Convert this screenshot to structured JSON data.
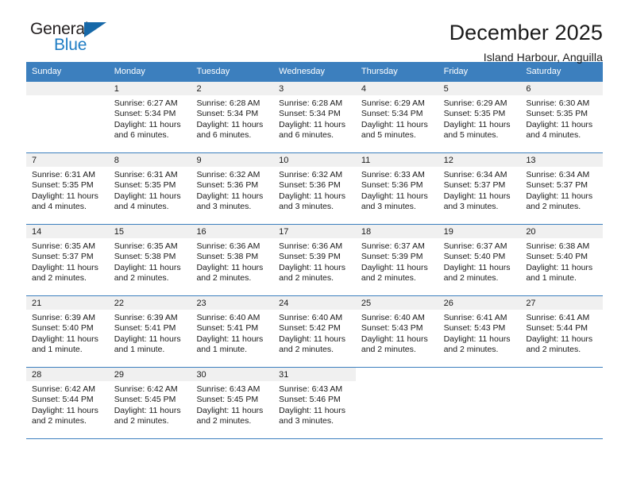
{
  "logo": {
    "word_one": "General",
    "word_two": "Blue",
    "triangle_icon": "triangle-icon"
  },
  "header": {
    "title": "December 2025",
    "subtitle": "Island Harbour, Anguilla"
  },
  "colors": {
    "header_blue": "#3c7fbe",
    "logo_blue": "#1f7dc4",
    "date_strip_gray": "#f0f0f0",
    "text": "#1a1a1a"
  },
  "calendar": {
    "weekday_headers": [
      "Sunday",
      "Monday",
      "Tuesday",
      "Wednesday",
      "Thursday",
      "Friday",
      "Saturday"
    ],
    "weeks": [
      [
        {
          "date": "",
          "lines": [],
          "state": "empty"
        },
        {
          "date": "1",
          "lines": [
            "Sunrise: 6:27 AM",
            "Sunset: 5:34 PM",
            "Daylight: 11 hours",
            "and 6 minutes."
          ],
          "state": "filled"
        },
        {
          "date": "2",
          "lines": [
            "Sunrise: 6:28 AM",
            "Sunset: 5:34 PM",
            "Daylight: 11 hours",
            "and 6 minutes."
          ],
          "state": "filled"
        },
        {
          "date": "3",
          "lines": [
            "Sunrise: 6:28 AM",
            "Sunset: 5:34 PM",
            "Daylight: 11 hours",
            "and 6 minutes."
          ],
          "state": "filled"
        },
        {
          "date": "4",
          "lines": [
            "Sunrise: 6:29 AM",
            "Sunset: 5:34 PM",
            "Daylight: 11 hours",
            "and 5 minutes."
          ],
          "state": "filled"
        },
        {
          "date": "5",
          "lines": [
            "Sunrise: 6:29 AM",
            "Sunset: 5:35 PM",
            "Daylight: 11 hours",
            "and 5 minutes."
          ],
          "state": "filled"
        },
        {
          "date": "6",
          "lines": [
            "Sunrise: 6:30 AM",
            "Sunset: 5:35 PM",
            "Daylight: 11 hours",
            "and 4 minutes."
          ],
          "state": "filled"
        }
      ],
      [
        {
          "date": "7",
          "lines": [
            "Sunrise: 6:31 AM",
            "Sunset: 5:35 PM",
            "Daylight: 11 hours",
            "and 4 minutes."
          ],
          "state": "filled"
        },
        {
          "date": "8",
          "lines": [
            "Sunrise: 6:31 AM",
            "Sunset: 5:35 PM",
            "Daylight: 11 hours",
            "and 4 minutes."
          ],
          "state": "filled"
        },
        {
          "date": "9",
          "lines": [
            "Sunrise: 6:32 AM",
            "Sunset: 5:36 PM",
            "Daylight: 11 hours",
            "and 3 minutes."
          ],
          "state": "filled"
        },
        {
          "date": "10",
          "lines": [
            "Sunrise: 6:32 AM",
            "Sunset: 5:36 PM",
            "Daylight: 11 hours",
            "and 3 minutes."
          ],
          "state": "filled"
        },
        {
          "date": "11",
          "lines": [
            "Sunrise: 6:33 AM",
            "Sunset: 5:36 PM",
            "Daylight: 11 hours",
            "and 3 minutes."
          ],
          "state": "filled"
        },
        {
          "date": "12",
          "lines": [
            "Sunrise: 6:34 AM",
            "Sunset: 5:37 PM",
            "Daylight: 11 hours",
            "and 3 minutes."
          ],
          "state": "filled"
        },
        {
          "date": "13",
          "lines": [
            "Sunrise: 6:34 AM",
            "Sunset: 5:37 PM",
            "Daylight: 11 hours",
            "and 2 minutes."
          ],
          "state": "filled"
        }
      ],
      [
        {
          "date": "14",
          "lines": [
            "Sunrise: 6:35 AM",
            "Sunset: 5:37 PM",
            "Daylight: 11 hours",
            "and 2 minutes."
          ],
          "state": "filled"
        },
        {
          "date": "15",
          "lines": [
            "Sunrise: 6:35 AM",
            "Sunset: 5:38 PM",
            "Daylight: 11 hours",
            "and 2 minutes."
          ],
          "state": "filled"
        },
        {
          "date": "16",
          "lines": [
            "Sunrise: 6:36 AM",
            "Sunset: 5:38 PM",
            "Daylight: 11 hours",
            "and 2 minutes."
          ],
          "state": "filled"
        },
        {
          "date": "17",
          "lines": [
            "Sunrise: 6:36 AM",
            "Sunset: 5:39 PM",
            "Daylight: 11 hours",
            "and 2 minutes."
          ],
          "state": "filled"
        },
        {
          "date": "18",
          "lines": [
            "Sunrise: 6:37 AM",
            "Sunset: 5:39 PM",
            "Daylight: 11 hours",
            "and 2 minutes."
          ],
          "state": "filled"
        },
        {
          "date": "19",
          "lines": [
            "Sunrise: 6:37 AM",
            "Sunset: 5:40 PM",
            "Daylight: 11 hours",
            "and 2 minutes."
          ],
          "state": "filled"
        },
        {
          "date": "20",
          "lines": [
            "Sunrise: 6:38 AM",
            "Sunset: 5:40 PM",
            "Daylight: 11 hours",
            "and 1 minute."
          ],
          "state": "filled"
        }
      ],
      [
        {
          "date": "21",
          "lines": [
            "Sunrise: 6:39 AM",
            "Sunset: 5:40 PM",
            "Daylight: 11 hours",
            "and 1 minute."
          ],
          "state": "filled"
        },
        {
          "date": "22",
          "lines": [
            "Sunrise: 6:39 AM",
            "Sunset: 5:41 PM",
            "Daylight: 11 hours",
            "and 1 minute."
          ],
          "state": "filled"
        },
        {
          "date": "23",
          "lines": [
            "Sunrise: 6:40 AM",
            "Sunset: 5:41 PM",
            "Daylight: 11 hours",
            "and 1 minute."
          ],
          "state": "filled"
        },
        {
          "date": "24",
          "lines": [
            "Sunrise: 6:40 AM",
            "Sunset: 5:42 PM",
            "Daylight: 11 hours",
            "and 2 minutes."
          ],
          "state": "filled"
        },
        {
          "date": "25",
          "lines": [
            "Sunrise: 6:40 AM",
            "Sunset: 5:43 PM",
            "Daylight: 11 hours",
            "and 2 minutes."
          ],
          "state": "filled"
        },
        {
          "date": "26",
          "lines": [
            "Sunrise: 6:41 AM",
            "Sunset: 5:43 PM",
            "Daylight: 11 hours",
            "and 2 minutes."
          ],
          "state": "filled"
        },
        {
          "date": "27",
          "lines": [
            "Sunrise: 6:41 AM",
            "Sunset: 5:44 PM",
            "Daylight: 11 hours",
            "and 2 minutes."
          ],
          "state": "filled"
        }
      ],
      [
        {
          "date": "28",
          "lines": [
            "Sunrise: 6:42 AM",
            "Sunset: 5:44 PM",
            "Daylight: 11 hours",
            "and 2 minutes."
          ],
          "state": "filled"
        },
        {
          "date": "29",
          "lines": [
            "Sunrise: 6:42 AM",
            "Sunset: 5:45 PM",
            "Daylight: 11 hours",
            "and 2 minutes."
          ],
          "state": "filled"
        },
        {
          "date": "30",
          "lines": [
            "Sunrise: 6:43 AM",
            "Sunset: 5:45 PM",
            "Daylight: 11 hours",
            "and 2 minutes."
          ],
          "state": "filled"
        },
        {
          "date": "31",
          "lines": [
            "Sunrise: 6:43 AM",
            "Sunset: 5:46 PM",
            "Daylight: 11 hours",
            "and 3 minutes."
          ],
          "state": "filled"
        },
        {
          "date": "",
          "lines": [],
          "state": "blank"
        },
        {
          "date": "",
          "lines": [],
          "state": "blank"
        },
        {
          "date": "",
          "lines": [],
          "state": "blank"
        }
      ]
    ]
  }
}
